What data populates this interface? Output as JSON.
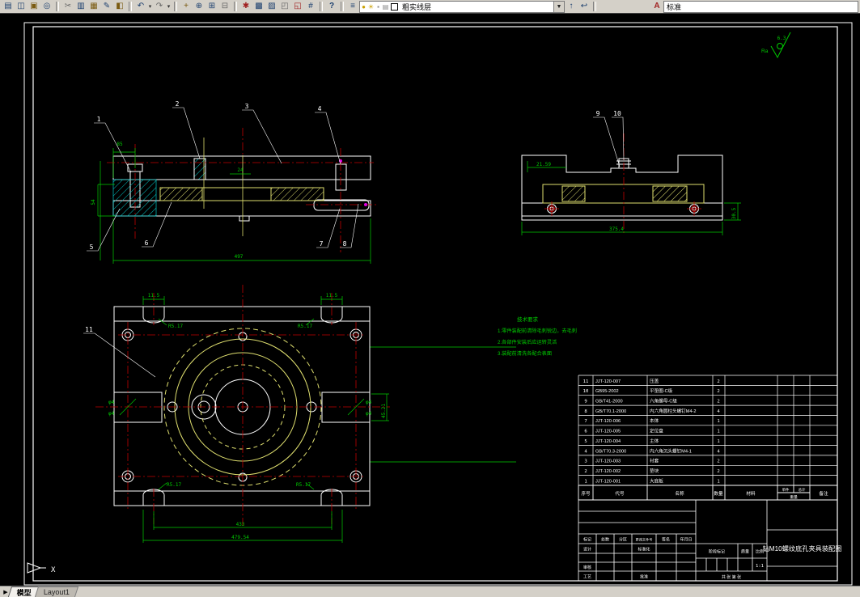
{
  "toolbar": {
    "icons": {
      "plot": "▤",
      "preview": "◫",
      "publish": "▣",
      "web": "◎",
      "cut": "✂",
      "copy": "▥",
      "paste": "▦",
      "match": "✎",
      "blockedit": "◧",
      "undo": "↶",
      "redo": "↷",
      "pan": "+",
      "zoomrt": "⊕",
      "zoomwin": "⊞",
      "zoomprev": "⊟",
      "props": "✱",
      "dcenter": "▩",
      "palettes": "▨",
      "sheetset": "◰",
      "markup": "◱",
      "calc": "#",
      "help": "?",
      "layers": "≡",
      "bulb": "●",
      "sun": "☀",
      "lock": "▪",
      "plotstate": "▤",
      "makecur": "↑",
      "layerprev": "↩",
      "textstyle": "A"
    },
    "layer_combo": {
      "value": "粗实线层"
    },
    "style_combo": {
      "value": "标准"
    }
  },
  "drawing": {
    "ucs_x": "X",
    "surface": {
      "ra": "Ra",
      "value": "6.3"
    },
    "notes": {
      "title": "技术要求",
      "line1": "1.零件装配前清除毛刺锐边，去毛刺",
      "line2": "2.各部件安装后应运转灵活",
      "line3": "3.装配前清洗各配合表面"
    },
    "front": {
      "b1": "1",
      "b2": "2",
      "b3": "3",
      "b4": "4",
      "b5": "5",
      "b6": "6",
      "b7": "7",
      "b8": "8",
      "dim85": "85",
      "dim54": "54",
      "dim497": "497",
      "dim24": "24"
    },
    "side": {
      "b9": "9",
      "b10": "10",
      "dim_top": "21.59",
      "dim_bottom": "375.4",
      "dim_right": "30.5"
    },
    "plan": {
      "b11": "11",
      "dim_slot": "11.5",
      "r_label": "R5.17",
      "hole": "φ4",
      "dim_inner": "433",
      "dim_outer": "479.54",
      "dim_right": "45.21"
    }
  },
  "bom": {
    "header": {
      "no": "序号",
      "code": "代号",
      "name": "名称",
      "qty": "数量",
      "material": "材料",
      "unit": "单件",
      "total": "总计",
      "weight": "重量",
      "note": "备注"
    },
    "rows": [
      {
        "no": "11",
        "code": "JJT-120-007",
        "name": "压盖",
        "qty": "2"
      },
      {
        "no": "10",
        "code": "GB95-2002",
        "name": "平垫圈-C级",
        "qty": "2"
      },
      {
        "no": "9",
        "code": "GB/T41-2000",
        "name": "六角螺母-C级",
        "qty": "2"
      },
      {
        "no": "8",
        "code": "GB/T70.1-2000",
        "name": "内六角圆柱头螺钉M4-2",
        "qty": "4"
      },
      {
        "no": "7",
        "code": "JJT-120-006",
        "name": "本体",
        "qty": "1"
      },
      {
        "no": "6",
        "code": "JJT-120-005",
        "name": "定位盘",
        "qty": "1"
      },
      {
        "no": "5",
        "code": "JJT-120-004",
        "name": "主体",
        "qty": "1"
      },
      {
        "no": "4",
        "code": "GB/T70.3-2000",
        "name": "内六角沉头螺钉M4-1",
        "qty": "4"
      },
      {
        "no": "3",
        "code": "JJT-120-003",
        "name": "衬套",
        "qty": "2"
      },
      {
        "no": "2",
        "code": "JJT-120-002",
        "name": "垫块",
        "qty": "2"
      },
      {
        "no": "1",
        "code": "JJT-120-001",
        "name": "大底板",
        "qty": "1"
      }
    ]
  },
  "titleblock": {
    "mark": "标记",
    "count": "处数",
    "zone": "分区",
    "docno": "更改文件号",
    "sign": "签名",
    "date": "年月日",
    "design": "设计",
    "standardize": "标准化",
    "check": "审核",
    "process": "工艺",
    "approve": "批准",
    "stage": "阶段标记",
    "mass": "质量",
    "scale": "比例",
    "scale_value": "1:1",
    "sheet": "共 张 第 张",
    "title": "钻M10螺纹底孔夹具装配图"
  },
  "statusbar": {
    "nav": "▶",
    "tab_model": "模型",
    "tab_layout": "Layout1"
  }
}
